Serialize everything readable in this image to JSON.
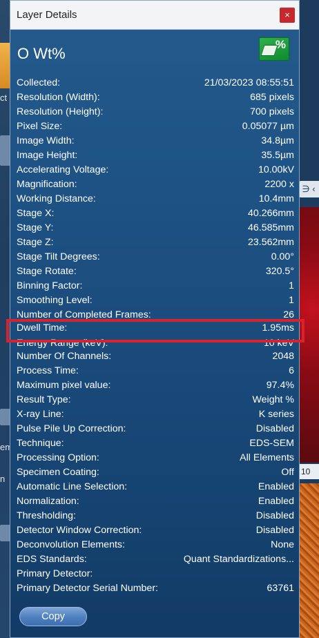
{
  "dialog": {
    "title": "Layer Details",
    "close_symbol": "×",
    "layer_name": "O Wt%",
    "icon": "percent-layer-icon",
    "rows": [
      {
        "label": "Collected:",
        "value": "21/03/2023 08:55:51"
      },
      {
        "label": "Resolution (Width):",
        "value": "685 pixels"
      },
      {
        "label": "Resolution (Height):",
        "value": "700 pixels"
      },
      {
        "label": "Pixel Size:",
        "value": "0.05077 µm"
      },
      {
        "label": "Image Width:",
        "value": "34.8µm"
      },
      {
        "label": "Image Height:",
        "value": "35.5µm"
      },
      {
        "label": "Accelerating Voltage:",
        "value": "10.00kV"
      },
      {
        "label": "Magnification:",
        "value": "2200 x"
      },
      {
        "label": "Working Distance:",
        "value": "10.4mm"
      },
      {
        "label": "Stage X:",
        "value": "40.266mm"
      },
      {
        "label": "Stage Y:",
        "value": "46.585mm"
      },
      {
        "label": "Stage Z:",
        "value": "23.562mm"
      },
      {
        "label": "Stage Tilt Degrees:",
        "value": "0.00°"
      },
      {
        "label": "Stage Rotate:",
        "value": "320.5°"
      },
      {
        "label": "Binning Factor:",
        "value": "1"
      },
      {
        "label": "Smoothing Level:",
        "value": "1"
      },
      {
        "label": "Number of Completed Frames:",
        "value": "26"
      },
      {
        "label": "Dwell Time:",
        "value": "1.95ms"
      },
      {
        "label": "Energy Range (keV):",
        "value": "10 keV"
      },
      {
        "label": "Number Of Channels:",
        "value": "2048"
      },
      {
        "label": "Process Time:",
        "value": "6"
      },
      {
        "label": "Maximum pixel value:",
        "value": "97.4%"
      },
      {
        "label": "Result Type:",
        "value": "Weight %"
      },
      {
        "label": "X-ray Line:",
        "value": "K series"
      },
      {
        "label": "Pulse Pile Up Correction:",
        "value": "Disabled"
      },
      {
        "label": "Technique:",
        "value": "EDS-SEM"
      },
      {
        "label": "Processing Option:",
        "value": "All Elements"
      },
      {
        "label": "Specimen Coating:",
        "value": "Off"
      },
      {
        "label": "Automatic Line Selection:",
        "value": "Enabled"
      },
      {
        "label": "Normalization:",
        "value": "Enabled"
      },
      {
        "label": "Thresholding:",
        "value": "Disabled"
      },
      {
        "label": "Detector Window Correction:",
        "value": "Disabled"
      },
      {
        "label": "Deconvolution Elements:",
        "value": "None"
      },
      {
        "label": "EDS Standards:",
        "value": "Quant Standardizations..."
      },
      {
        "label": "Primary Detector:",
        "value": ""
      },
      {
        "label": "Primary Detector Serial Number:",
        "value": "63761"
      }
    ],
    "copy_label": "Copy",
    "highlight_color": "#d8232f"
  },
  "background": {
    "left_labels": [
      "ct",
      "em",
      "n"
    ],
    "right_tool_label": "∋ ‹",
    "right_number": "10"
  }
}
